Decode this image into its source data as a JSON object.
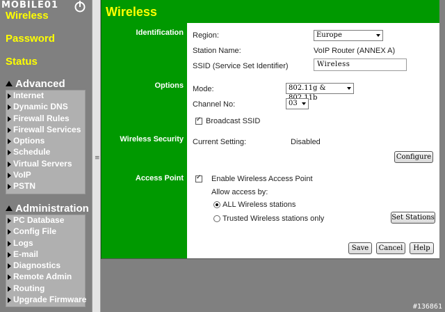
{
  "logo": {
    "text": "MOBILE01"
  },
  "sidebar": {
    "top_links": [
      "Wireless",
      "Password",
      "Status"
    ],
    "advanced": {
      "heading": "Advanced",
      "items": [
        "Internet",
        "Dynamic DNS",
        "Firewall Rules",
        "Firewall Services",
        "Options",
        "Schedule",
        "Virtual Servers",
        "VoIP",
        "PSTN"
      ]
    },
    "administration": {
      "heading": "Administration",
      "items": [
        "PC Database",
        "Config File",
        "Logs",
        "E-mail",
        "Diagnostics",
        "Remote Admin",
        "Routing",
        "Upgrade Firmware"
      ]
    }
  },
  "splitter": {
    "grip": "≡"
  },
  "main": {
    "title": "Wireless",
    "sections": {
      "identification": "Identification",
      "options": "Options",
      "wireless_security": "Wireless Security",
      "access_point": "Access Point"
    },
    "region": {
      "label": "Region:",
      "value": "Europe"
    },
    "station_name": {
      "label": "Station Name:",
      "value": "VoIP Router (ANNEX A)"
    },
    "ssid": {
      "label": "SSID (Service Set Identifier)",
      "value": "Wireless"
    },
    "mode": {
      "label": "Mode:",
      "value": "802.11g & 802.11b"
    },
    "channel": {
      "label": "Channel No:",
      "value": "03"
    },
    "broadcast_ssid": {
      "label": "Broadcast SSID",
      "checked": true
    },
    "current_setting": {
      "label": "Current Setting:",
      "value": "Disabled"
    },
    "configure_label": "Configure",
    "enable_ap": {
      "label": "Enable Wireless Access Point",
      "checked": true
    },
    "allow_access_label": "Allow access by:",
    "radio_all": {
      "label": "ALL Wireless stations",
      "selected": true
    },
    "radio_trusted": {
      "label": "Trusted Wireless stations only",
      "selected": false
    },
    "set_stations_label": "Set Stations",
    "buttons": {
      "save": "Save",
      "cancel": "Cancel",
      "help": "Help"
    }
  },
  "watermark": "#136861"
}
